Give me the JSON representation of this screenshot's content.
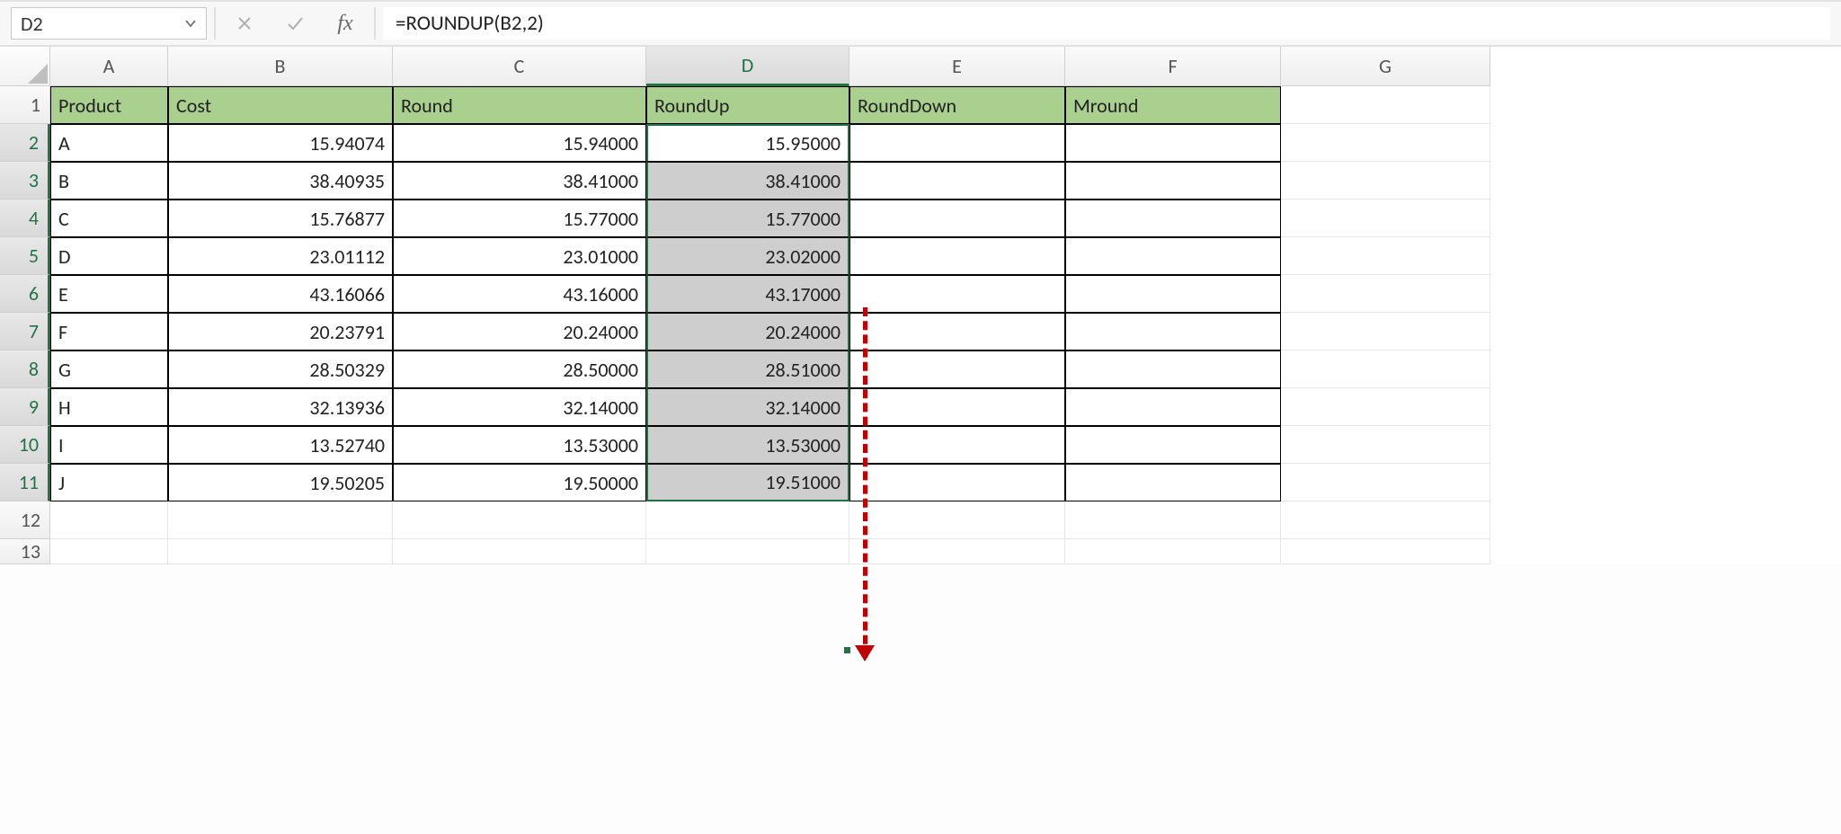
{
  "namebox": {
    "value": "D2"
  },
  "formula": "=ROUNDUP(B2,2)",
  "icons": {
    "dropdown": "chevron",
    "cancel": "×",
    "enter": "✓",
    "fx": "fx"
  },
  "columns": [
    "A",
    "B",
    "C",
    "D",
    "E",
    "F",
    "G"
  ],
  "rows": [
    "1",
    "2",
    "3",
    "4",
    "5",
    "6",
    "7",
    "8",
    "9",
    "10",
    "11",
    "12",
    "13"
  ],
  "headers": [
    "Product",
    "Cost",
    "Round",
    "RoundUp",
    "RoundDown",
    "Mround"
  ],
  "data": [
    {
      "p": "A",
      "cost": "15.94074",
      "round": "15.94000",
      "ru": "15.95000"
    },
    {
      "p": "B",
      "cost": "38.40935",
      "round": "38.41000",
      "ru": "38.41000"
    },
    {
      "p": "C",
      "cost": "15.76877",
      "round": "15.77000",
      "ru": "15.77000"
    },
    {
      "p": "D",
      "cost": "23.01112",
      "round": "23.01000",
      "ru": "23.02000"
    },
    {
      "p": "E",
      "cost": "43.16066",
      "round": "43.16000",
      "ru": "43.17000"
    },
    {
      "p": "F",
      "cost": "20.23791",
      "round": "20.24000",
      "ru": "20.24000"
    },
    {
      "p": "G",
      "cost": "28.50329",
      "round": "28.50000",
      "ru": "28.51000"
    },
    {
      "p": "H",
      "cost": "32.13936",
      "round": "32.14000",
      "ru": "32.14000"
    },
    {
      "p": "I",
      "cost": "13.52740",
      "round": "13.53000",
      "ru": "13.53000"
    },
    {
      "p": "J",
      "cost": "19.50205",
      "round": "19.50000",
      "ru": "19.51000"
    }
  ],
  "chart_data": {
    "type": "table",
    "title": "Rounding comparison by product",
    "columns": [
      "Product",
      "Cost",
      "Round",
      "RoundUp",
      "RoundDown",
      "Mround"
    ],
    "rows": [
      [
        "A",
        15.94074,
        15.94,
        15.95,
        null,
        null
      ],
      [
        "B",
        38.40935,
        38.41,
        38.41,
        null,
        null
      ],
      [
        "C",
        15.76877,
        15.77,
        15.77,
        null,
        null
      ],
      [
        "D",
        23.01112,
        23.01,
        23.02,
        null,
        null
      ],
      [
        "E",
        43.16066,
        43.16,
        43.17,
        null,
        null
      ],
      [
        "F",
        20.23791,
        20.24,
        20.24,
        null,
        null
      ],
      [
        "G",
        28.50329,
        28.5,
        28.51,
        null,
        null
      ],
      [
        "H",
        32.13936,
        32.14,
        32.14,
        null,
        null
      ],
      [
        "I",
        13.5274,
        13.53,
        13.53,
        null,
        null
      ],
      [
        "J",
        19.50205,
        19.5,
        19.51,
        null,
        null
      ]
    ]
  }
}
